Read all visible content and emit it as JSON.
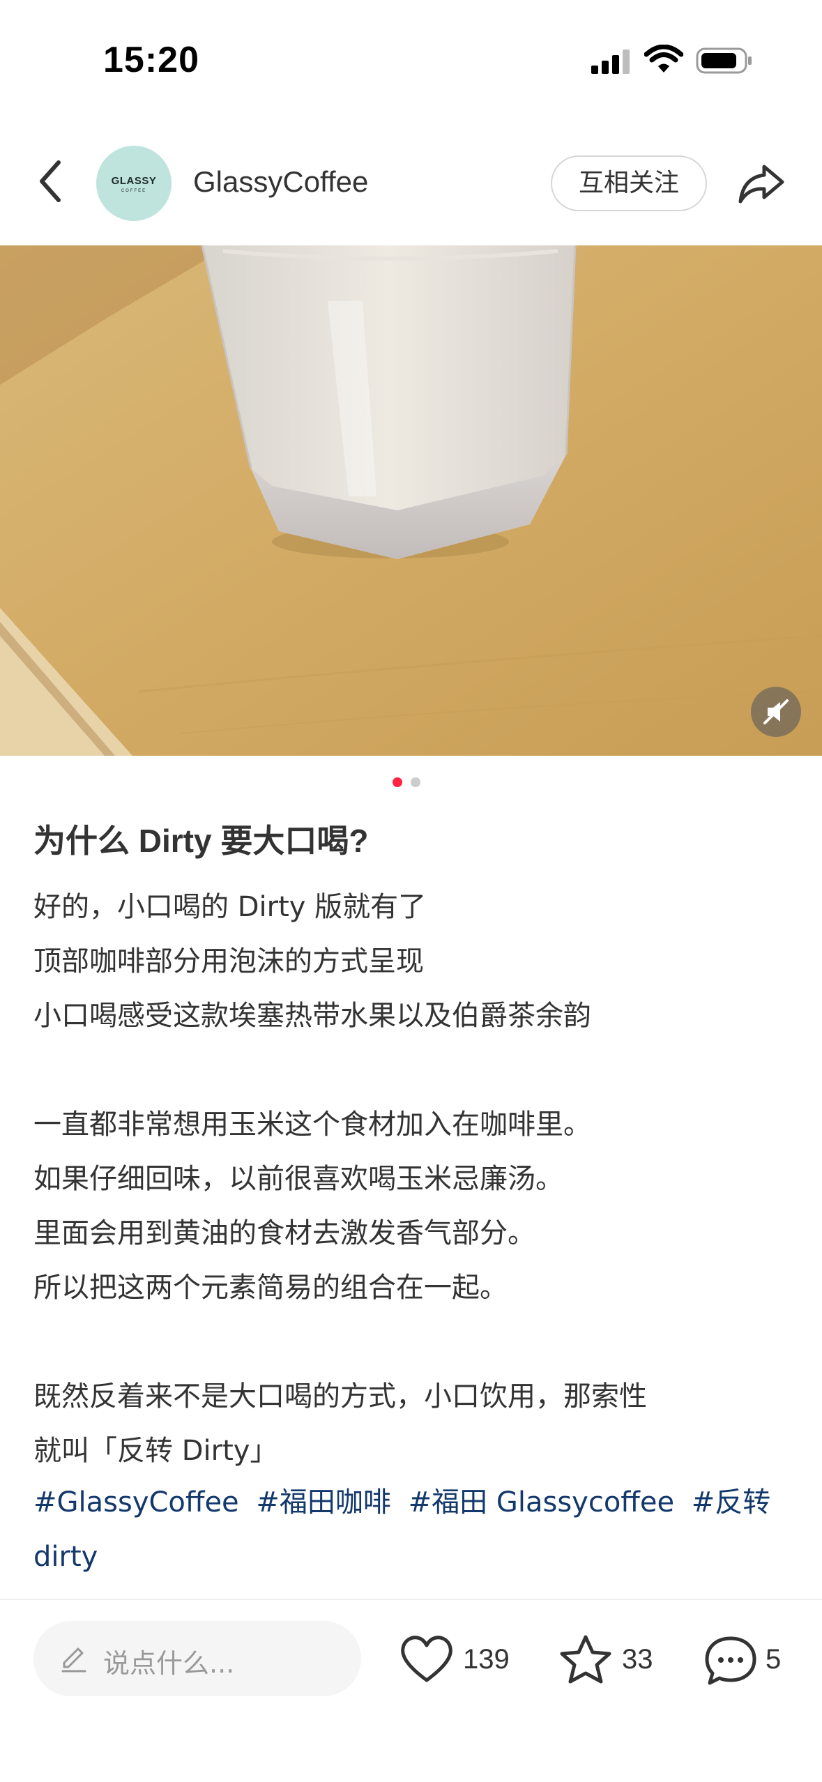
{
  "status_bar": {
    "time": "15:20"
  },
  "header": {
    "author_name": "GlassyCoffee",
    "avatar_logo_text": "GLASSY",
    "avatar_logo_sub": "COFFEE",
    "follow_label": "互相关注"
  },
  "pager": {
    "total": 2,
    "active": 1
  },
  "post": {
    "title": "为什么 Dirty 要大口喝?",
    "paragraphs": [
      [
        "好的，小口喝的 Dirty 版就有了",
        "顶部咖啡部分用泡沫的方式呈现",
        "小口喝感受这款埃塞热带水果以及伯爵茶余韵"
      ],
      [
        "一直都非常想用玉米这个食材加入在咖啡里。",
        "如果仔细回味，以前很喜欢喝玉米忌廉汤。",
        "里面会用到黄油的食材去激发香气部分。",
        "所以把这两个元素简易的组合在一起。"
      ],
      [
        "既然反着来不是大口喝的方式，小口饮用，那索性",
        "就叫「反转 Dirty」"
      ]
    ],
    "hashtags": [
      "#GlassyCoffee",
      "#福田咖啡",
      "#福田 Glassycoffee",
      "#反转 dirty"
    ]
  },
  "bottom_bar": {
    "comment_placeholder": "说点什么...",
    "likes": "139",
    "collects": "33",
    "comments": "5"
  },
  "colors": {
    "accent": "#ff2442",
    "hashtag": "#13386c",
    "avatar_bg": "#bfe3dd"
  }
}
